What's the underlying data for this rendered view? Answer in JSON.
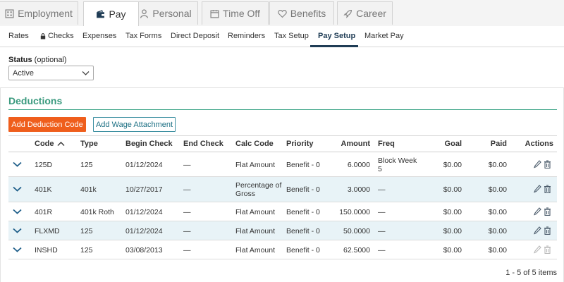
{
  "top_tabs": [
    {
      "label": "Employment",
      "icon": "building-icon",
      "active": false
    },
    {
      "label": "Pay",
      "icon": "wallet-icon",
      "active": true
    },
    {
      "label": "Personal",
      "icon": "person-icon",
      "active": false
    },
    {
      "label": "Time Off",
      "icon": "calendar-icon",
      "active": false
    },
    {
      "label": "Benefits",
      "icon": "heart-icon",
      "active": false
    },
    {
      "label": "Career",
      "icon": "rocket-icon",
      "active": false
    }
  ],
  "sub_tabs": [
    {
      "label": "Rates"
    },
    {
      "label": "Checks",
      "icon": "lock-icon"
    },
    {
      "label": "Expenses"
    },
    {
      "label": "Tax Forms"
    },
    {
      "label": "Direct Deposit"
    },
    {
      "label": "Reminders"
    },
    {
      "label": "Tax Setup"
    },
    {
      "label": "Pay Setup",
      "active": true
    },
    {
      "label": "Market Pay"
    }
  ],
  "status": {
    "label_bold": "Status",
    "label_optional": " (optional)",
    "value": "Active"
  },
  "deductions": {
    "title": "Deductions",
    "add_code_label": "Add Deduction Code",
    "add_wage_label": "Add Wage Attachment",
    "columns": {
      "code": "Code",
      "type": "Type",
      "begin": "Begin Check",
      "end": "End Check",
      "calc": "Calc Code",
      "priority": "Priority",
      "amount": "Amount",
      "freq": "Freq",
      "goal": "Goal",
      "paid": "Paid",
      "actions": "Actions"
    },
    "sort_column": "Code",
    "rows": [
      {
        "code": "125D",
        "type": "125",
        "begin": "01/12/2024",
        "end": "—",
        "calc": "Flat Amount",
        "priority": "Benefit - 0",
        "amount": "6.0000",
        "freq": "Block Week 5",
        "goal": "$0.00",
        "paid": "$0.00",
        "actions_enabled": true
      },
      {
        "code": "401K",
        "type": "401k",
        "begin": "10/27/2017",
        "end": "—",
        "calc": "Percentage of Gross",
        "priority": "Benefit - 0",
        "amount": "3.0000",
        "freq": "—",
        "goal": "$0.00",
        "paid": "$0.00",
        "actions_enabled": true
      },
      {
        "code": "401R",
        "type": "401k Roth",
        "begin": "01/12/2024",
        "end": "—",
        "calc": "Flat Amount",
        "priority": "Benefit - 0",
        "amount": "150.0000",
        "freq": "—",
        "goal": "$0.00",
        "paid": "$0.00",
        "actions_enabled": true
      },
      {
        "code": "FLXMD",
        "type": "125",
        "begin": "01/12/2024",
        "end": "—",
        "calc": "Flat Amount",
        "priority": "Benefit - 0",
        "amount": "50.0000",
        "freq": "—",
        "goal": "$0.00",
        "paid": "$0.00",
        "actions_enabled": true
      },
      {
        "code": "INSHD",
        "type": "125",
        "begin": "03/08/2013",
        "end": "—",
        "calc": "Flat Amount",
        "priority": "Benefit - 0",
        "amount": "62.5000",
        "freq": "—",
        "goal": "$0.00",
        "paid": "$0.00",
        "actions_enabled": false
      }
    ],
    "pagination": "1 - 5 of 5 items"
  },
  "colors": {
    "accent_orange": "#ef5e1c",
    "accent_green": "#3a9a7e",
    "nav_dark": "#1f3c55",
    "row_alt": "#e8f3f7"
  }
}
